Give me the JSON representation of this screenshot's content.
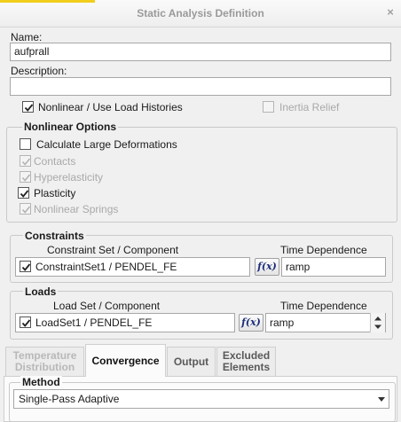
{
  "window": {
    "title": "Static Analysis Definition",
    "close_glyph": "×"
  },
  "name": {
    "label": "Name:",
    "value": "aufprall"
  },
  "description": {
    "label": "Description:",
    "value": ""
  },
  "options": {
    "nonlinear_label": "Nonlinear / Use Load Histories",
    "nonlinear_checked": true,
    "inertia_label": "Inertia Relief",
    "inertia_checked": false
  },
  "nonlinear_options": {
    "title": "Nonlinear Options",
    "items": [
      {
        "label": "Calculate Large Deformations",
        "checked": false,
        "enabled": true
      },
      {
        "label": "Contacts",
        "checked": true,
        "enabled": false
      },
      {
        "label": "Hyperelasticity",
        "checked": true,
        "enabled": false
      },
      {
        "label": "Plasticity",
        "checked": true,
        "enabled": true
      },
      {
        "label": "Nonlinear Springs",
        "checked": true,
        "enabled": false
      }
    ]
  },
  "constraints": {
    "title": "Constraints",
    "col_set": "Constraint Set / Component",
    "col_time": "Time Dependence",
    "row": {
      "checked": true,
      "set": "ConstraintSet1 / PENDEL_FE",
      "fx_label": "f(x)",
      "time": "ramp"
    }
  },
  "loads": {
    "title": "Loads",
    "col_set": "Load Set / Component",
    "col_time": "Time Dependence",
    "row": {
      "checked": true,
      "set": "LoadSet1 / PENDEL_FE",
      "fx_label": "f(x)",
      "time": "ramp"
    }
  },
  "tabs": [
    {
      "label": "Temperature Distribution",
      "state": "disabled"
    },
    {
      "label": "Convergence",
      "state": "active"
    },
    {
      "label": "Output",
      "state": "normal"
    },
    {
      "label": "Excluded Elements",
      "state": "normal"
    }
  ],
  "convergence": {
    "method_label": "Method",
    "method_value": "Single-Pass Adaptive"
  },
  "colors": {
    "accent": "#f2ce1c",
    "fx_text": "#1c2f7a",
    "disabled_text": "#a9a9a9"
  },
  "icons": {
    "checkmark": "checkmark-icon",
    "dropdown": "chevron-down-icon",
    "spin_up": "triangle-up-icon",
    "spin_down": "triangle-down-icon"
  }
}
